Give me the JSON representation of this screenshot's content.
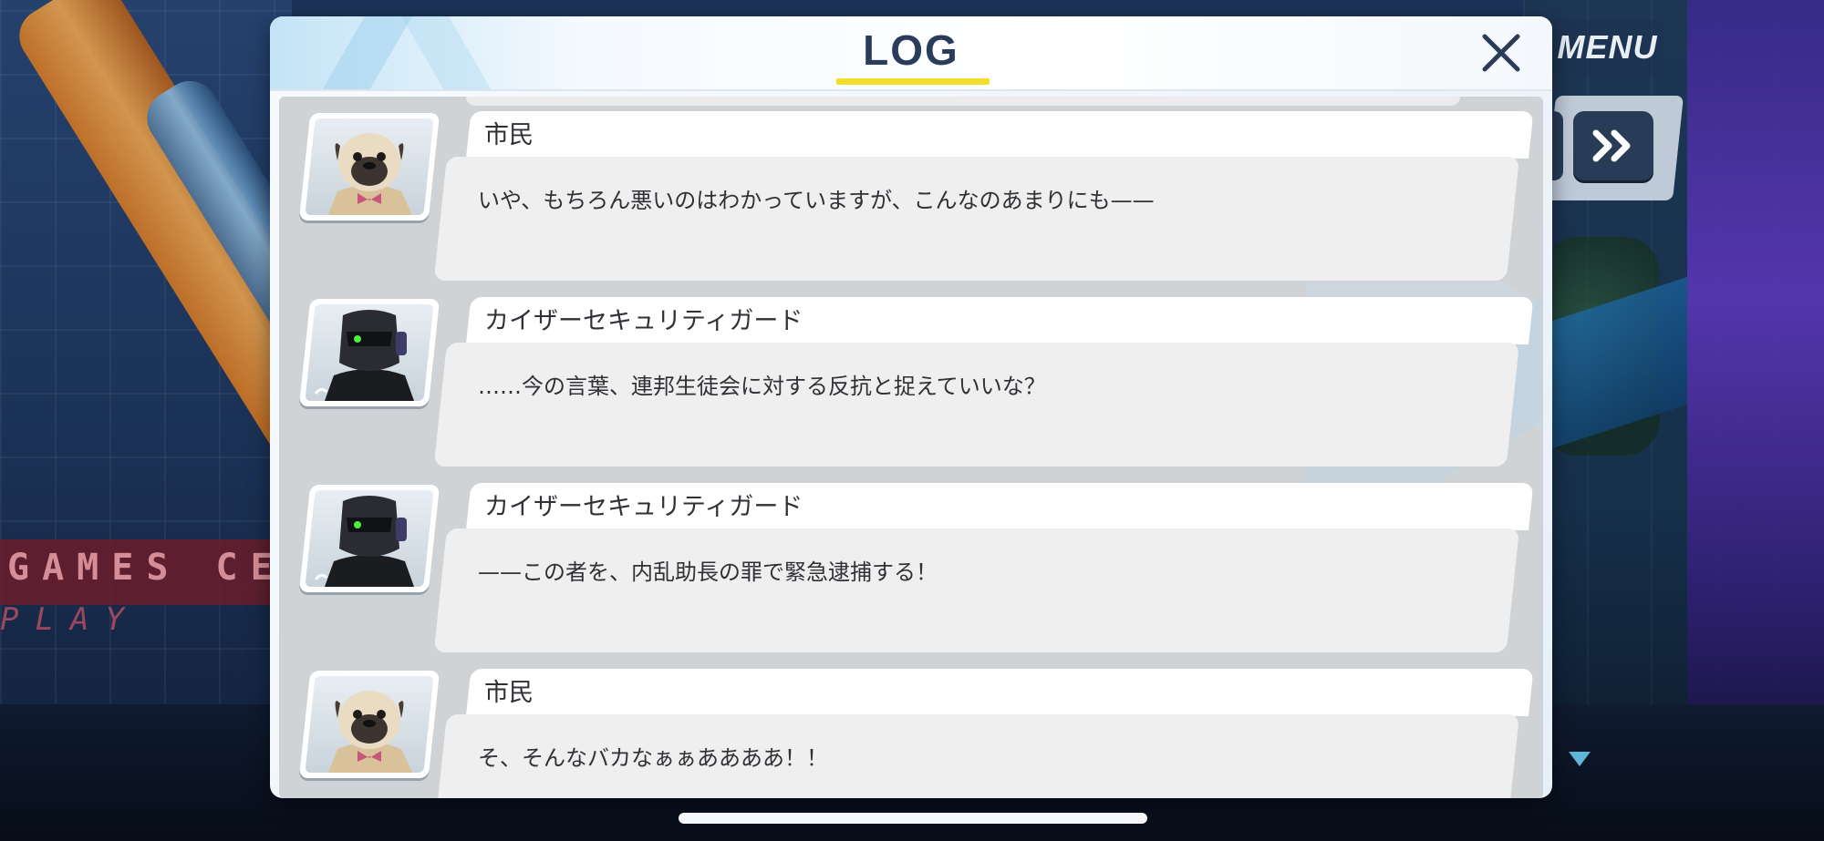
{
  "log_window": {
    "title": "LOG",
    "entries": [
      {
        "speaker": "市民",
        "portrait": "pug-citizen",
        "text": "いや、もちろん悪いのはわかっていますが、こんなのあまりにも——"
      },
      {
        "speaker": "カイザーセキュリティガード",
        "portrait": "kaiser-security-guard",
        "text": "……今の言葉、連邦生徒会に対する反抗と捉えていいな？"
      },
      {
        "speaker": "カイザーセキュリティガード",
        "portrait": "kaiser-security-guard",
        "text": "——この者を、内乱助長の罪で緊急逮捕する！"
      },
      {
        "speaker": "市民",
        "portrait": "pug-citizen",
        "text": "そ、そんなバカなぁぁああああ！！"
      }
    ]
  },
  "controls": {
    "menu_label": "MENU",
    "fast_forward_icon": "double-chevron-right-icon",
    "close_icon": "close-icon",
    "scroll_indicator_icon": "triangle-down-icon"
  },
  "background": {
    "sign_text": "GAMES CEN",
    "sign_subtext": "PLAY"
  },
  "colors": {
    "title": "#2a3c5a",
    "underline_accent": "#f3de2c",
    "body_bg": "#d0d3d6",
    "text_box": "#efefef",
    "name_plate": "#ffffff",
    "ff_button": "#283b57"
  }
}
